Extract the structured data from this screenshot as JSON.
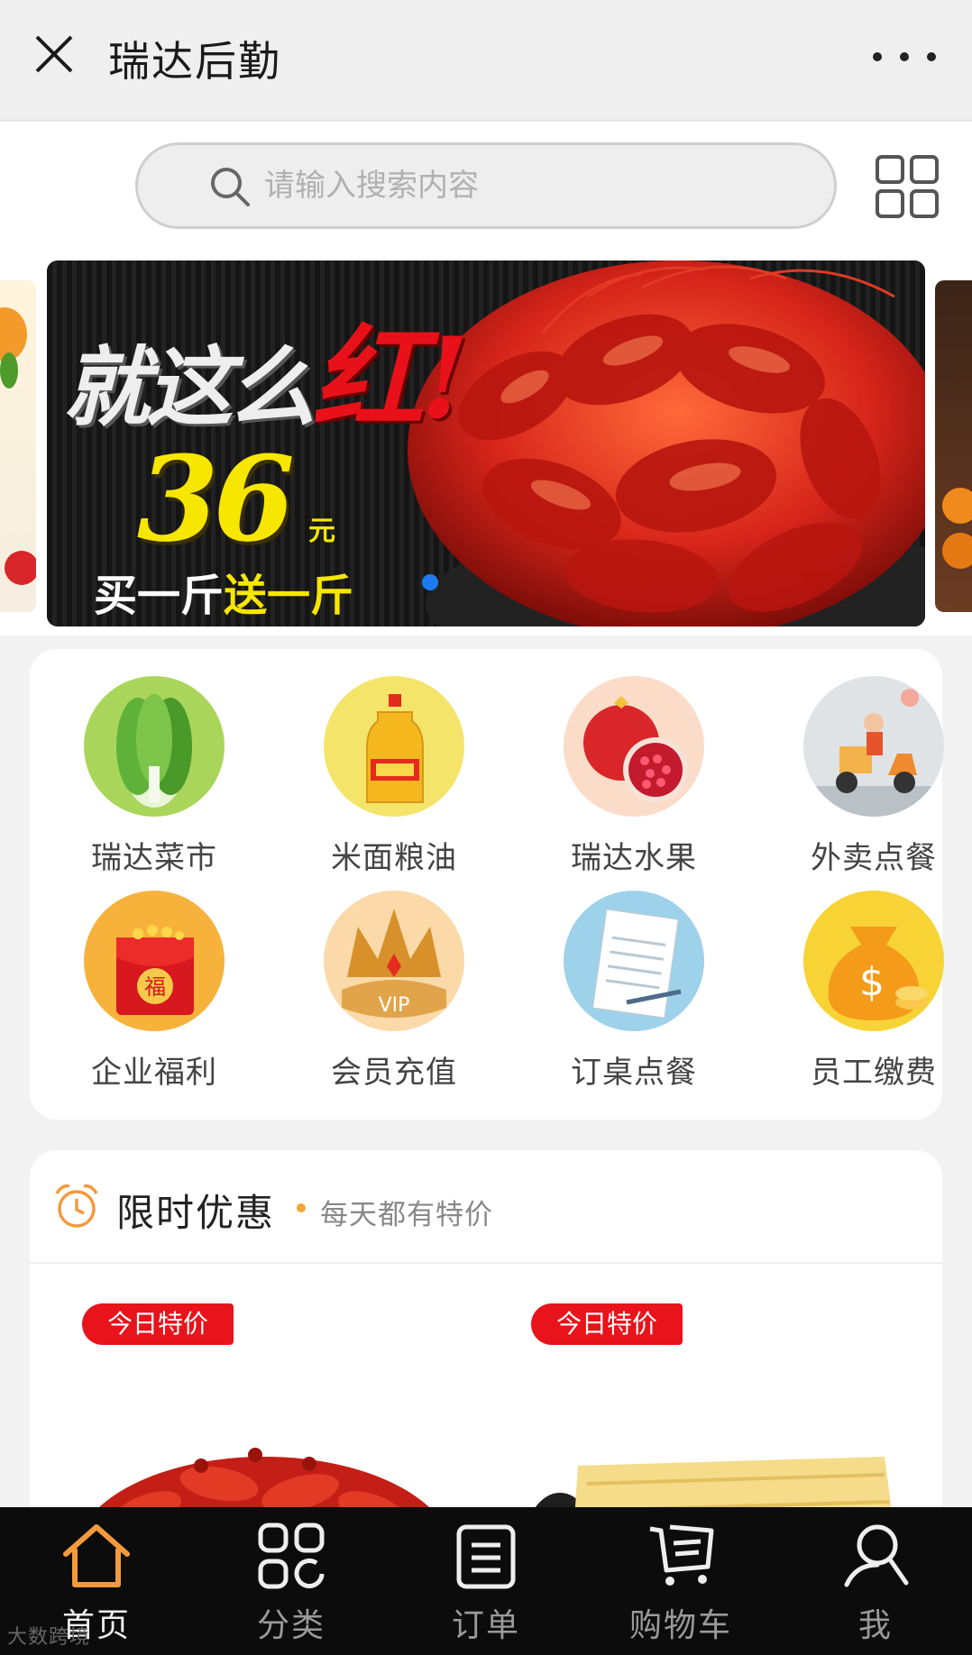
{
  "header": {
    "title": "瑞达后勤",
    "close_icon": "close-icon",
    "more_icon": "more-dots-icon"
  },
  "search": {
    "placeholder": "请输入搜索内容",
    "value": "",
    "grid_icon": "grid-icon"
  },
  "banner": {
    "headline_white": "就这么",
    "headline_red": "红!",
    "price": "36",
    "price_unit": "元",
    "promo_white": "买一斤",
    "promo_yellow": "送一斤",
    "active_slide_indicator_color": "#1e7af0"
  },
  "categories": [
    {
      "label": "瑞达菜市",
      "icon": "cabbage-icon"
    },
    {
      "label": "米面粮油",
      "icon": "oil-bottle-icon"
    },
    {
      "label": "瑞达水果",
      "icon": "pomegranate-icon"
    },
    {
      "label": "外卖点餐",
      "icon": "delivery-scooter-icon"
    },
    {
      "label": "企业福利",
      "icon": "red-envelope-icon"
    },
    {
      "label": "会员充值",
      "icon": "vip-crown-icon"
    },
    {
      "label": "订桌点餐",
      "icon": "notepad-icon"
    },
    {
      "label": "员工缴费",
      "icon": "money-bag-icon"
    }
  ],
  "promo": {
    "title": "限时优惠",
    "subtitle": "每天都有特价",
    "icon": "alarm-clock-icon",
    "products": [
      {
        "tag": "今日特价",
        "image": "crayfish-image"
      },
      {
        "tag": "今日特价",
        "image": "tofu-skin-image"
      }
    ]
  },
  "tabbar": {
    "items": [
      {
        "label": "首页",
        "icon": "home-icon",
        "active": true
      },
      {
        "label": "分类",
        "icon": "category-icon",
        "active": false
      },
      {
        "label": "订单",
        "icon": "order-icon",
        "active": false
      },
      {
        "label": "购物车",
        "icon": "cart-icon",
        "active": false
      },
      {
        "label": "我",
        "icon": "user-icon",
        "active": false
      }
    ],
    "active_color": "#f39a3c"
  },
  "watermark": "大数跨境",
  "colors": {
    "accent_red": "#e8131b",
    "accent_orange": "#f39a3c",
    "banner_yellow": "#f7e600"
  }
}
